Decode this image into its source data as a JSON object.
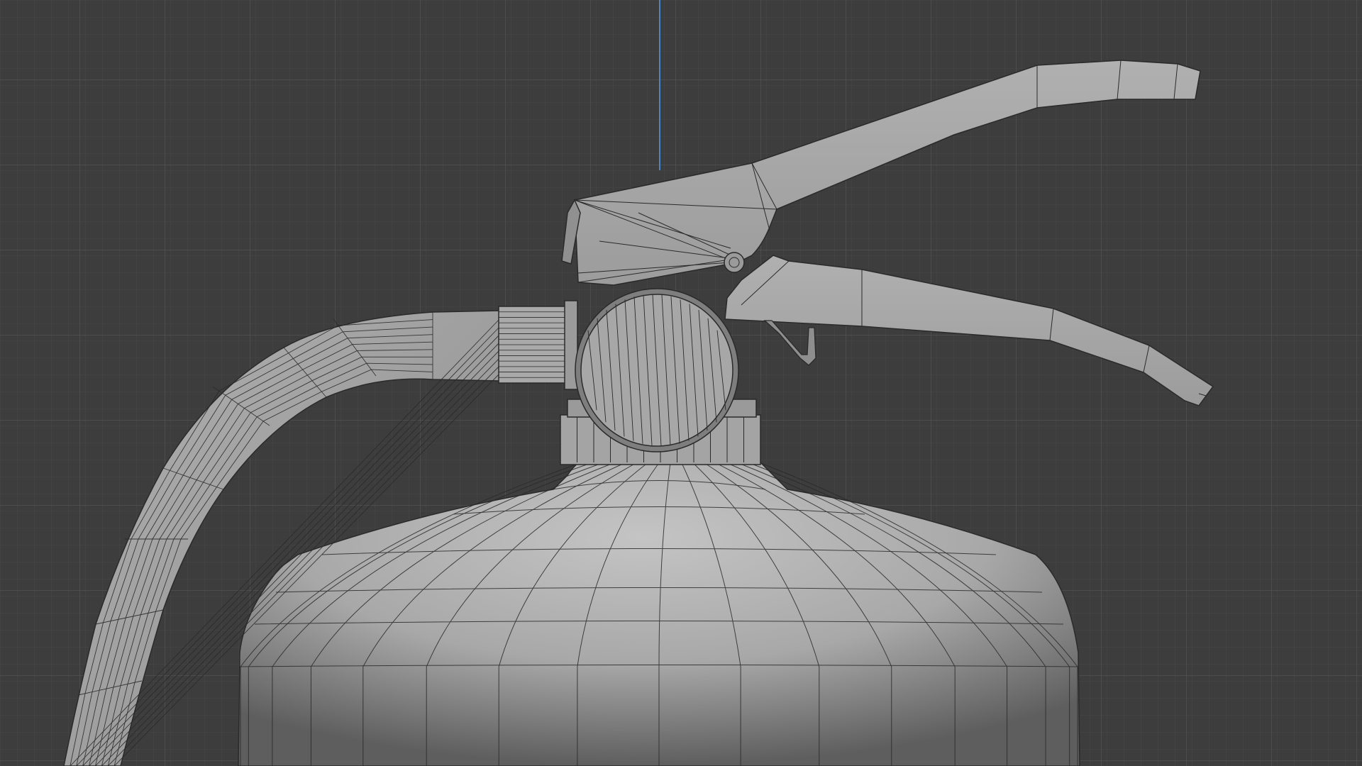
{
  "viewport": {
    "mode": "wireframe-overlay",
    "object": "fire-extinguisher",
    "colors": {
      "background": "#3d3d3d",
      "grid_minor": "#474747",
      "grid_major": "#555555",
      "axis_z": "#4a86c5",
      "mesh_fill": "#a6a6a6",
      "mesh_light": "#c4c5c4",
      "mesh_shadow": "#5c5c5c",
      "wire": "#2a2a2a"
    }
  }
}
